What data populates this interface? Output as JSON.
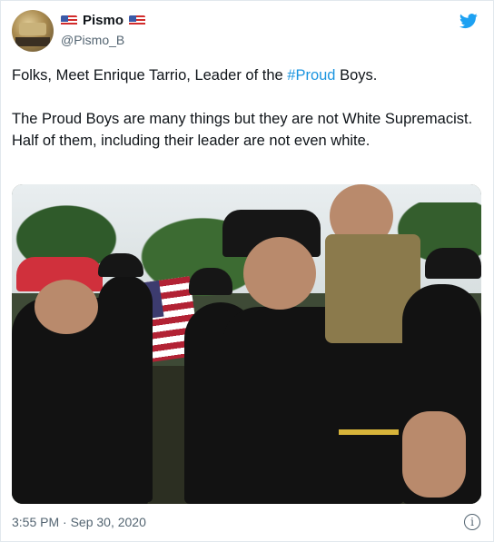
{
  "author": {
    "name": "Pismo",
    "handle": "@Pismo_B",
    "name_emoji": "flag-us-icon"
  },
  "tweet": {
    "line1_before": "Folks, Meet Enrique Tarrio, Leader of the ",
    "line1_hashtag": "#Proud",
    "line1_after": " Boys.",
    "paragraph2": "The Proud Boys are many things but they are not White Supremacist. Half of them, including their leader are not even white."
  },
  "timestamp": "3:55 PM · Sep 30, 2020",
  "icons": {
    "brand": "twitter-bird-icon",
    "info": "info-icon"
  },
  "colors": {
    "twitter_blue": "#1da1f2",
    "hashtag": "#1b95e0",
    "secondary_text": "#536471"
  }
}
